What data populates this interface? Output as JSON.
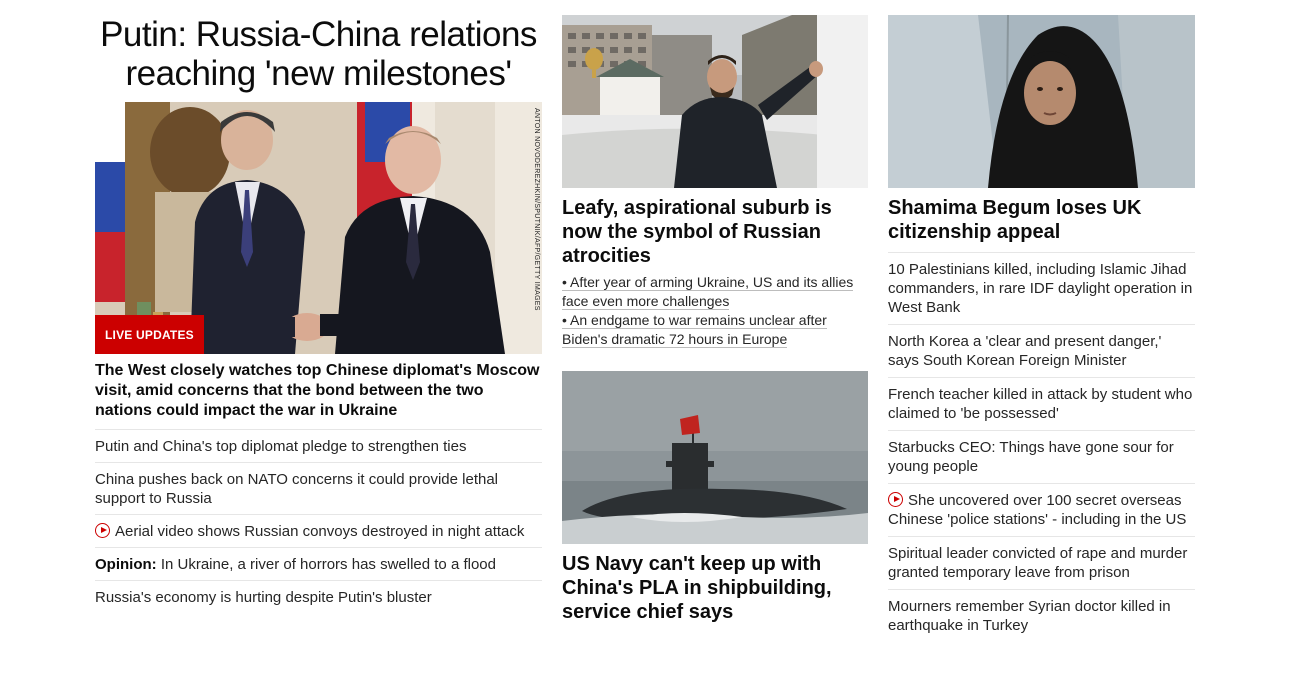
{
  "col1": {
    "headline": "Putin: Russia-China relations reaching 'new milestones'",
    "image_credit": "ANTON NOVODEREZHKIN/SPUTNIK/AFP/GETTY IMAGES",
    "badge": "LIVE UPDATES",
    "lead": "The West closely watches top Chinese diplomat's Moscow visit, amid concerns that the bond between the two nations could impact the war in Ukraine",
    "items": [
      {
        "text": "Putin and China's top diplomat pledge to strengthen ties"
      },
      {
        "text": "China pushes back on NATO concerns it could provide lethal support to Russia"
      },
      {
        "text": "Aerial video shows Russian convoys destroyed in night attack",
        "icon": "play-icon"
      },
      {
        "prefix": "Opinion:",
        "text": " In Ukraine, a river of horrors has swelled to a flood"
      },
      {
        "text": "Russia's economy is hurting despite Putin's bluster"
      }
    ]
  },
  "col2": {
    "card1_title": "Leafy, aspirational suburb is now the symbol of Russian atrocities",
    "card1_bullets": [
      "• After year of arming Ukraine, US and its allies face even more challenges",
      "• An endgame to war remains unclear after Biden's dramatic 72 hours in Europe"
    ],
    "card2_title": "US Navy can't keep up with China's PLA in shipbuilding, service chief says"
  },
  "col3": {
    "card_title": "Shamima Begum loses UK citizenship appeal",
    "items": [
      {
        "text": "10 Palestinians killed, including Islamic Jihad commanders, in rare IDF daylight operation in West Bank"
      },
      {
        "text": "North Korea a 'clear and present danger,' says South Korean Foreign Minister"
      },
      {
        "text": "French teacher killed in attack by student who claimed to 'be possessed'"
      },
      {
        "text": "Starbucks CEO: Things have gone sour for young people"
      },
      {
        "text": "She uncovered over 100 secret overseas Chinese 'police stations' - including in the US",
        "icon": "play-icon"
      },
      {
        "text": "Spiritual leader convicted of rape and murder granted temporary leave from prison"
      },
      {
        "text": "Mourners remember Syrian doctor killed in earthquake in Turkey"
      }
    ]
  },
  "colors": {
    "accent": "#cc0000",
    "divider": "#e6e6e6",
    "text": "#0c0c0c"
  }
}
